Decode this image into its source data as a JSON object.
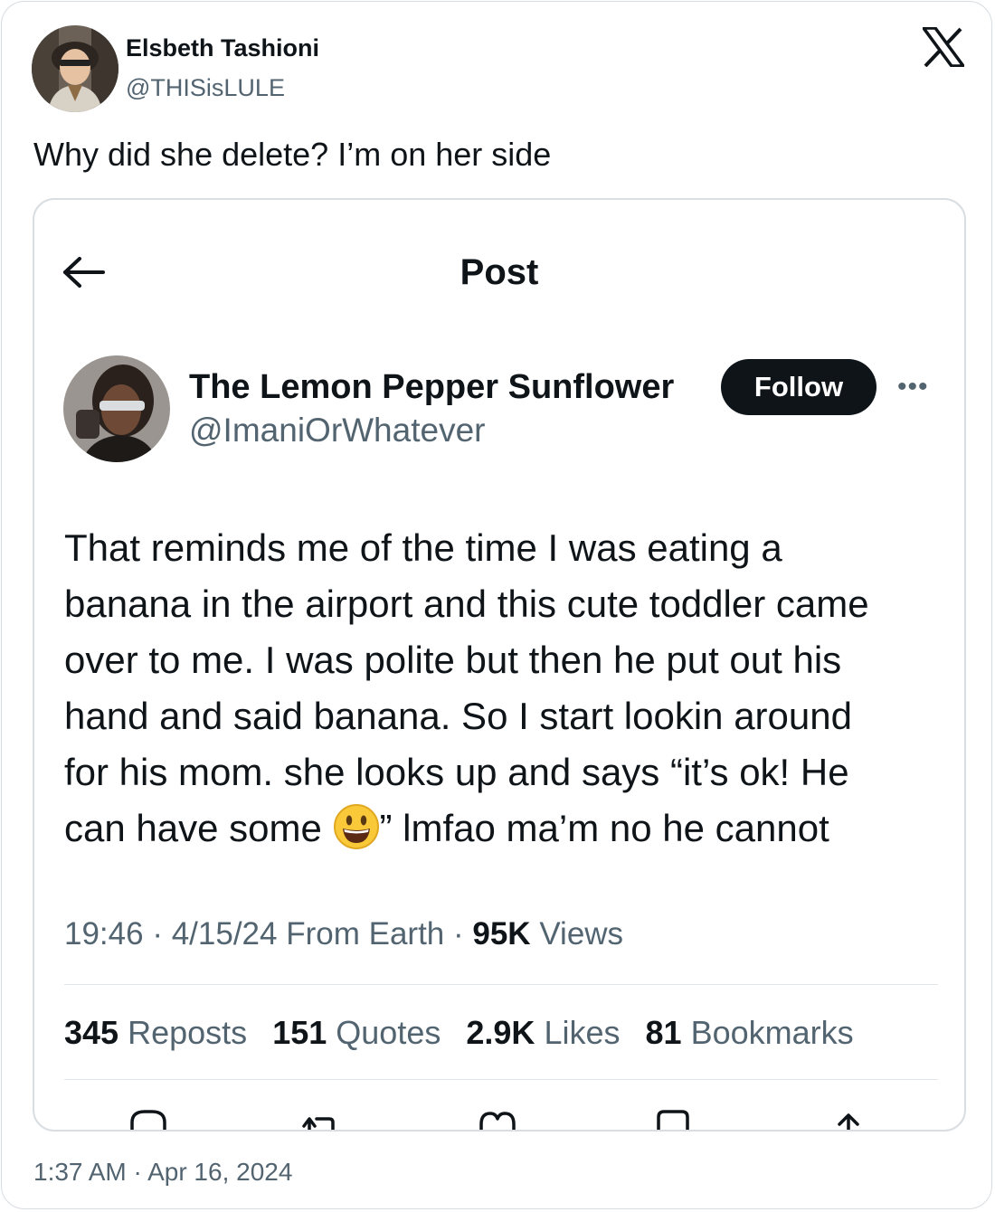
{
  "author": {
    "name": "Elsbeth Tashioni",
    "handle": "@THISisLULE"
  },
  "tweet": {
    "text": "Why did she delete? I’m on her side",
    "timestamp": "1:37 AM · Apr 16, 2024"
  },
  "embedded": {
    "header_title": "Post",
    "user": {
      "name": "The Lemon Pepper Sunflower",
      "handle": "@ImaniOrWhatever"
    },
    "follow_label": "Follow",
    "more_label": "•••",
    "text_lines": [
      "That reminds me of the time I was eating a",
      "banana in the airport and this cute toddler came",
      "over to me. I was polite but then he put out his",
      "hand and said banana. So I start lookin around",
      "for his mom. she looks up and says “it’s ok! He"
    ],
    "text_last_before": "can have some ",
    "text_last_after": "” lmfao ma’m no he cannot",
    "meta": {
      "time": "19:46",
      "date": "4/15/24",
      "location": "From Earth",
      "views": "95K",
      "views_label": "Views"
    },
    "stats": {
      "reposts": "345",
      "reposts_label": "Reposts",
      "quotes": "151",
      "quotes_label": "Quotes",
      "likes": "2.9K",
      "likes_label": "Likes",
      "bookmarks": "81",
      "bookmarks_label": "Bookmarks"
    }
  },
  "icons": [
    "x-logo-icon",
    "back-arrow-icon",
    "grinning-face-emoji-icon",
    "reply-icon",
    "repost-icon",
    "like-icon",
    "bookmark-icon",
    "share-icon"
  ],
  "colors": {
    "text": "#0f1419",
    "secondary": "#536471",
    "border": "#d7dce0",
    "button": "#0f1419"
  }
}
